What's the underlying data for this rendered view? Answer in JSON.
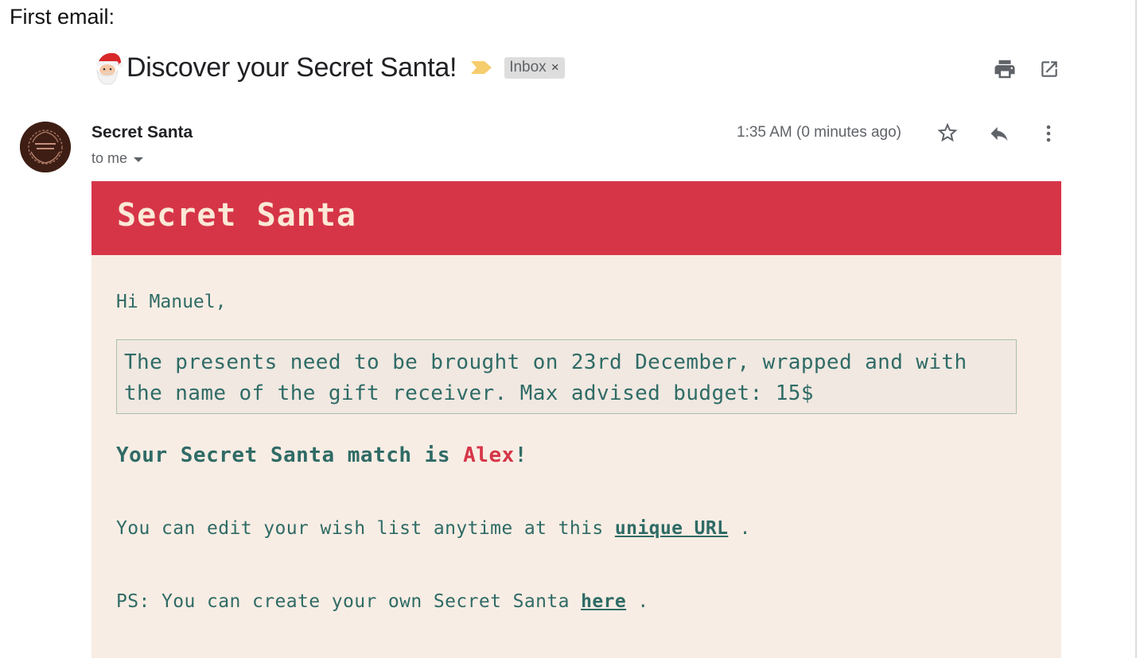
{
  "caption": "First email:",
  "header": {
    "subject": "Discover your Secret Santa!",
    "label_chip": "Inbox",
    "label_chip_remove": "×"
  },
  "message": {
    "sender_name": "Secret Santa",
    "recipient": "to me",
    "timestamp": "1:35 AM (0 minutes ago)"
  },
  "email": {
    "banner_title": "Secret Santa",
    "greeting": "Hi Manuel,",
    "notice": "The presents need to be brought on 23rd December, wrapped and with the name of the gift receiver. Max advised budget: 15$",
    "match_prefix": "Your Secret Santa match is ",
    "match_name": "Alex",
    "match_suffix": "!",
    "edit_prefix": "You can edit your wish list anytime at this ",
    "edit_link": "unique URL",
    "edit_suffix": " .",
    "ps_prefix": "PS: You can create your own Secret Santa ",
    "ps_link": "here",
    "ps_suffix": " ."
  },
  "icons": {
    "subject_emoji": "santa-emoji-icon",
    "importance": "importance-marker-icon",
    "print": "print-icon",
    "open_new_window": "open-in-new-window-icon",
    "star": "star-icon",
    "reply": "reply-icon",
    "more": "more-vert-icon",
    "recipient_dropdown": "chevron-down-icon"
  },
  "colors": {
    "banner": "#d63548",
    "banner_text": "#fbe9d6",
    "body_background": "#f8ede4",
    "body_text": "#2f6b66",
    "match_name": "#d63548",
    "importance_marker": "#f6cd6c",
    "avatar": "#3e1e14"
  }
}
